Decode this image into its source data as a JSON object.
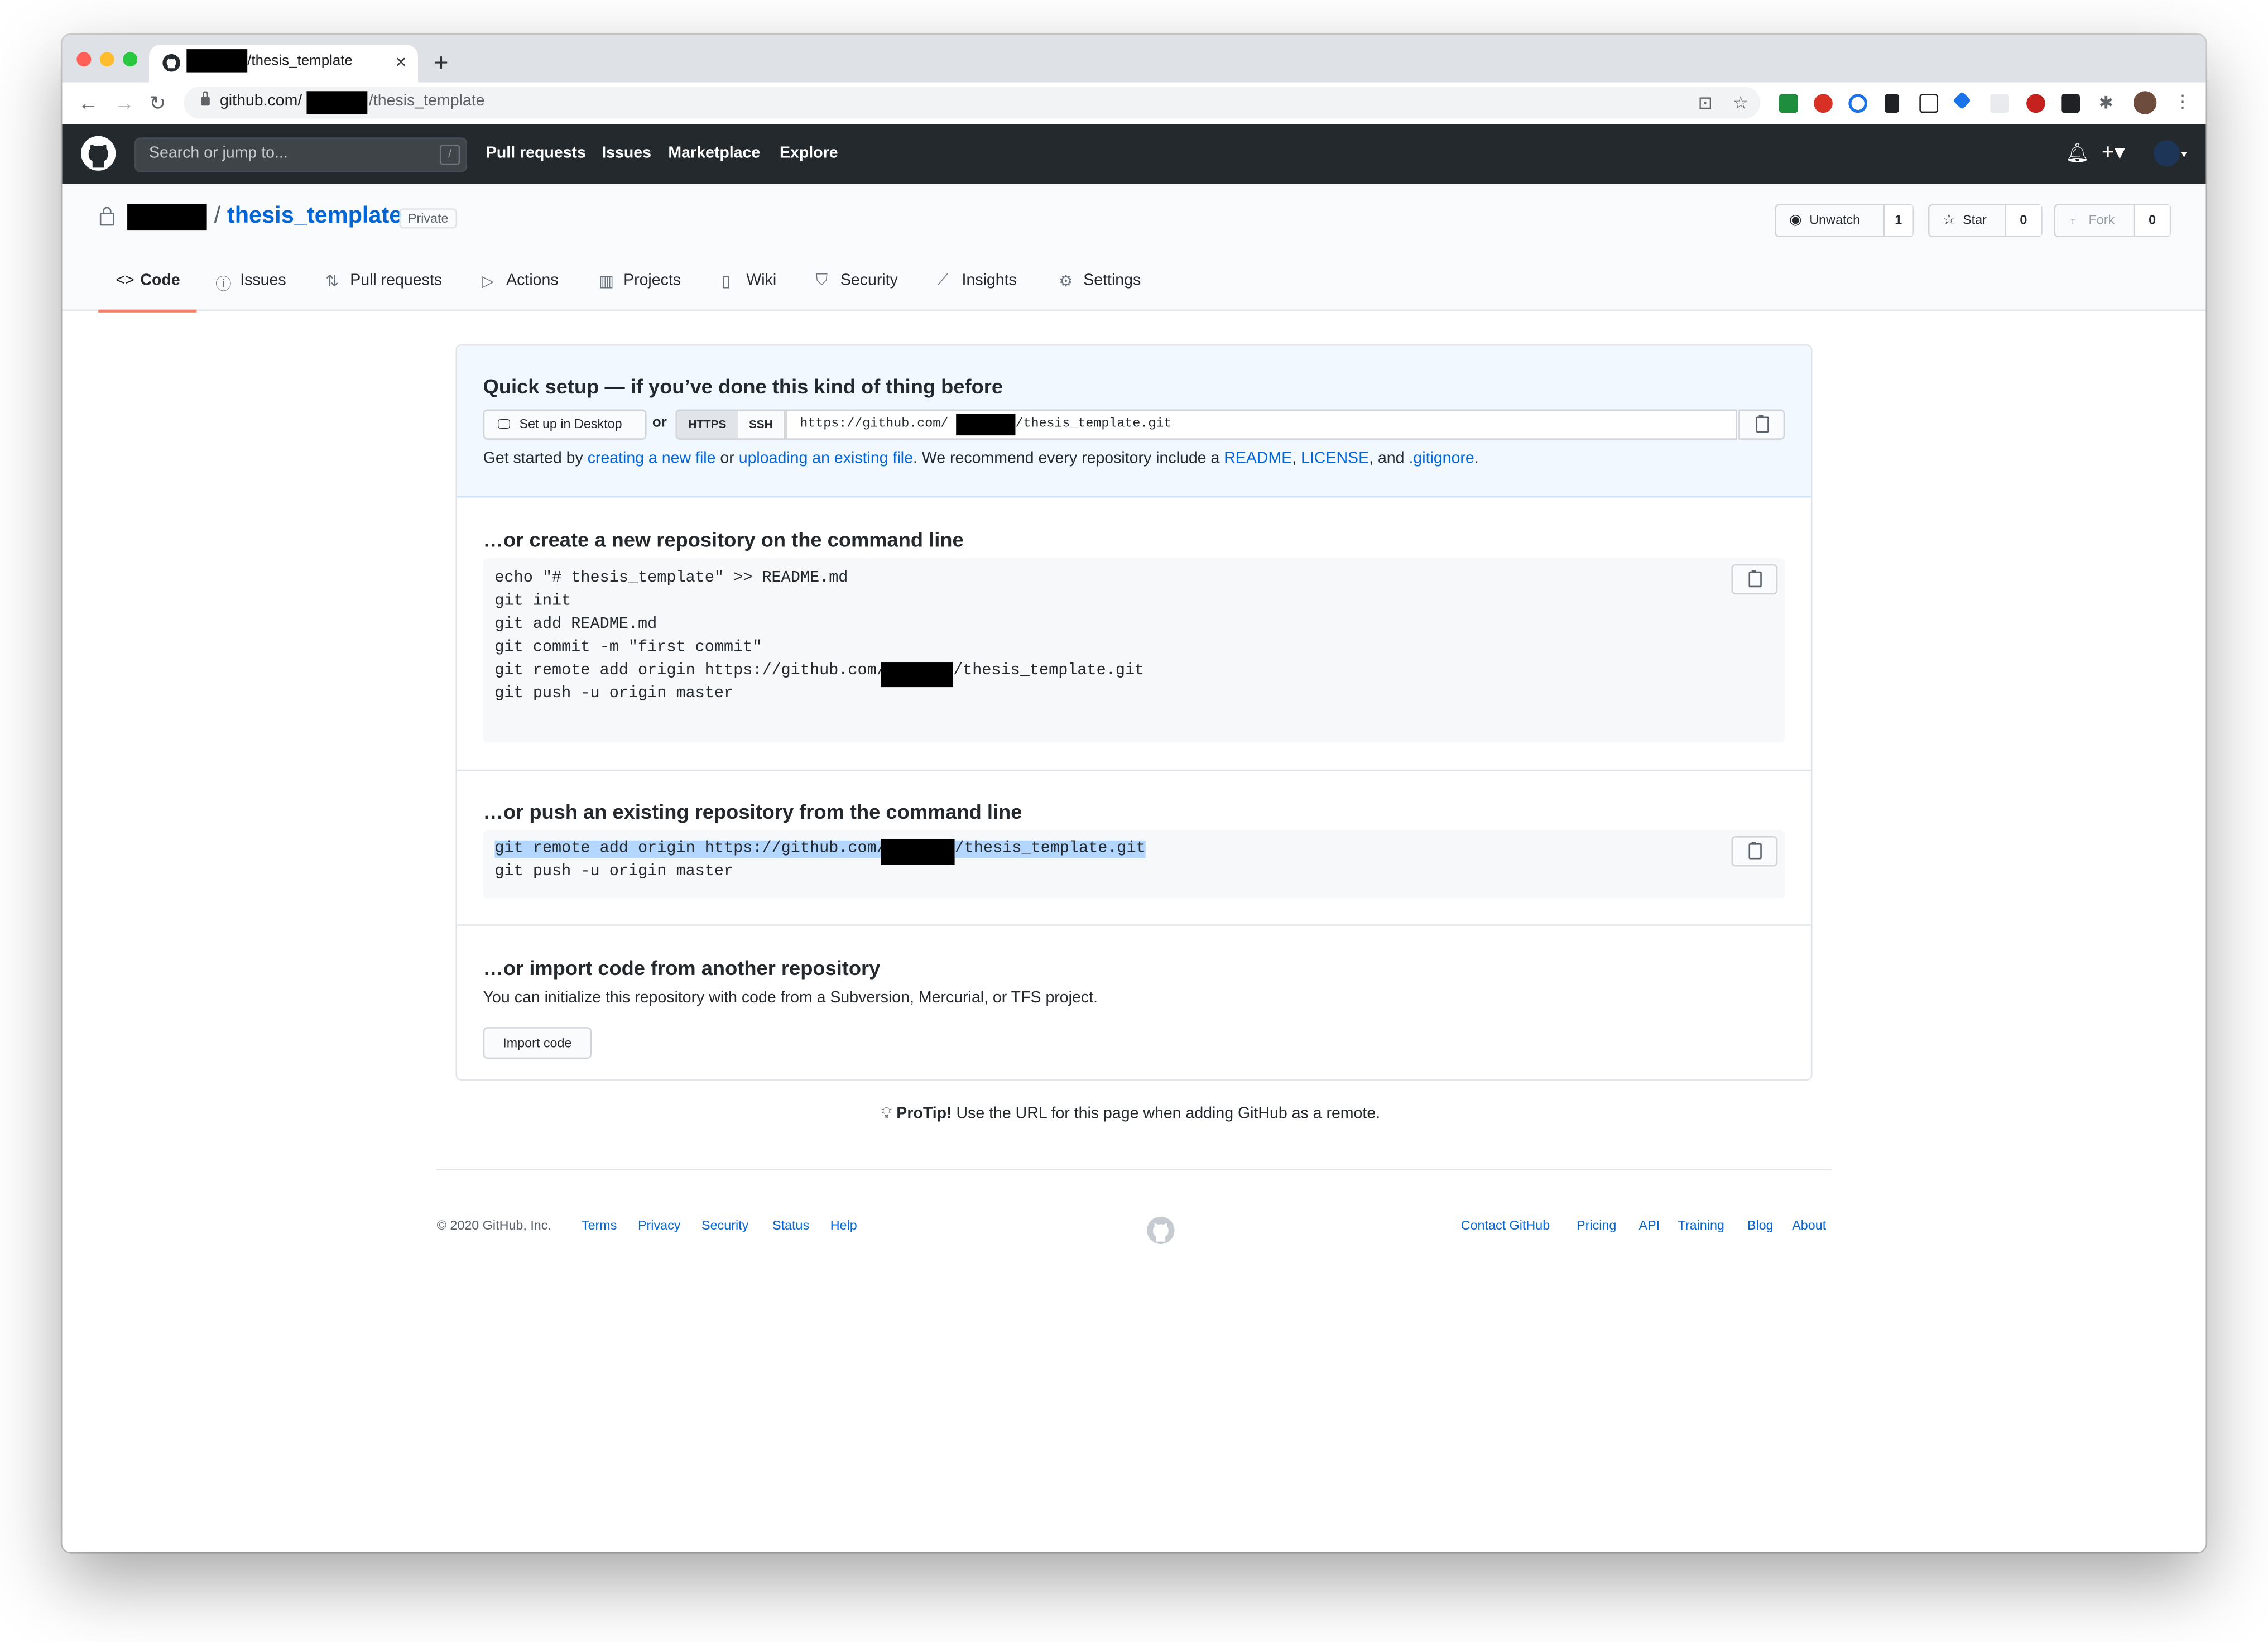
{
  "browser": {
    "tab_title": "/thesis_template",
    "tab_close": "×",
    "new_tab": "+",
    "url_host": "github.com/",
    "url_path": "/thesis_template",
    "back": "←",
    "forward": "→",
    "reload": "↻"
  },
  "header": {
    "search_placeholder": "Search or jump to...",
    "search_key": "/",
    "nav": [
      "Pull requests",
      "Issues",
      "Marketplace",
      "Explore"
    ]
  },
  "repo": {
    "name": "thesis_template",
    "slash": "/",
    "visibility": "Private",
    "unwatch_label": "Unwatch",
    "unwatch_count": "1",
    "star_label": "Star",
    "star_count": "0",
    "fork_label": "Fork",
    "fork_count": "0",
    "tabs": [
      "Code",
      "Issues",
      "Pull requests",
      "Actions",
      "Projects",
      "Wiki",
      "Security",
      "Insights",
      "Settings"
    ]
  },
  "quick_setup": {
    "title": "Quick setup — if you’ve done this kind of thing before",
    "desktop_button": "Set up in Desktop",
    "or": "or",
    "https": "HTTPS",
    "ssh": "SSH",
    "url_prefix": "https://github.com/",
    "url_suffix": "/thesis_template.git",
    "text_1": "Get started by ",
    "link_new_file": "creating a new file",
    "text_2": " or ",
    "link_upload": "uploading an existing file",
    "text_3": ". We recommend every repository include a ",
    "link_readme": "README",
    "text_4": ", ",
    "link_license": "LICENSE",
    "text_5": ", and ",
    "link_gitignore": ".gitignore",
    "text_6": "."
  },
  "new_repo": {
    "title": "…or create a new repository on the command line",
    "lines": [
      "echo \"# thesis_template\" >> README.md",
      "git init",
      "git add README.md",
      "git commit -m \"first commit\"",
      "git remote add origin https://github.com/",
      "git push -u origin master"
    ],
    "remote_suffix": "/thesis_template.git"
  },
  "push_repo": {
    "title": "…or push an existing repository from the command line",
    "line_1": "git remote add origin https://github.com/",
    "line_1_suffix": "/thesis_template.git",
    "line_2": "git push -u origin master"
  },
  "import_repo": {
    "title": "…or import code from another repository",
    "text": "You can initialize this repository with code from a Subversion, Mercurial, or TFS project.",
    "button": "Import code"
  },
  "protip": {
    "label": "ProTip!",
    "text": " Use the URL for this page when adding GitHub as a remote."
  },
  "footer": {
    "copyright": "© 2020 GitHub, Inc.",
    "left_links": [
      "Terms",
      "Privacy",
      "Security",
      "Status",
      "Help"
    ],
    "right_links": [
      "Contact GitHub",
      "Pricing",
      "API",
      "Training",
      "Blog",
      "About"
    ]
  },
  "colors": {
    "header_bg": "#24292e",
    "link": "#0366d6",
    "active_tab": "#f9826c",
    "quick_setup_bg": "#f1f8ff"
  }
}
